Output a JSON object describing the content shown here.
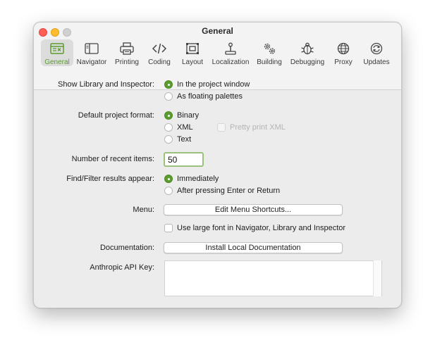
{
  "window": {
    "title": "General"
  },
  "toolbar": {
    "items": [
      {
        "label": "General",
        "icon": "general-icon",
        "active": true
      },
      {
        "label": "Navigator",
        "icon": "navigator-icon"
      },
      {
        "label": "Printing",
        "icon": "printer-icon"
      },
      {
        "label": "Coding",
        "icon": "code-icon"
      },
      {
        "label": "Layout",
        "icon": "layout-icon"
      },
      {
        "label": "Localization",
        "icon": "joystick-icon"
      },
      {
        "label": "Building",
        "icon": "gears-icon"
      },
      {
        "label": "Debugging",
        "icon": "bug-icon"
      },
      {
        "label": "Proxy",
        "icon": "globe-icon"
      },
      {
        "label": "Updates",
        "icon": "refresh-icon"
      }
    ],
    "accent_color": "#5a9c2e"
  },
  "settings": {
    "library_label": "Show Library and Inspector:",
    "library_options": [
      "In the project window",
      "As floating palettes"
    ],
    "library_selected": "In the project window",
    "format_label": "Default project format:",
    "format_options": [
      "Binary",
      "XML",
      "Text"
    ],
    "format_selected": "Binary",
    "pretty_print_label": "Pretty print XML",
    "recent_label": "Number of recent items:",
    "recent_value": "50",
    "find_label": "Find/Filter results appear:",
    "find_options": [
      "Immediately",
      "After pressing Enter or Return"
    ],
    "find_selected": "Immediately",
    "menu_label": "Menu:",
    "menu_button": "Edit Menu Shortcuts...",
    "large_font_label": "Use large font in Navigator, Library and Inspector",
    "docs_label": "Documentation:",
    "docs_button": "Install Local Documentation",
    "api_key_label": "Anthropic API Key:",
    "api_key_value": ""
  }
}
